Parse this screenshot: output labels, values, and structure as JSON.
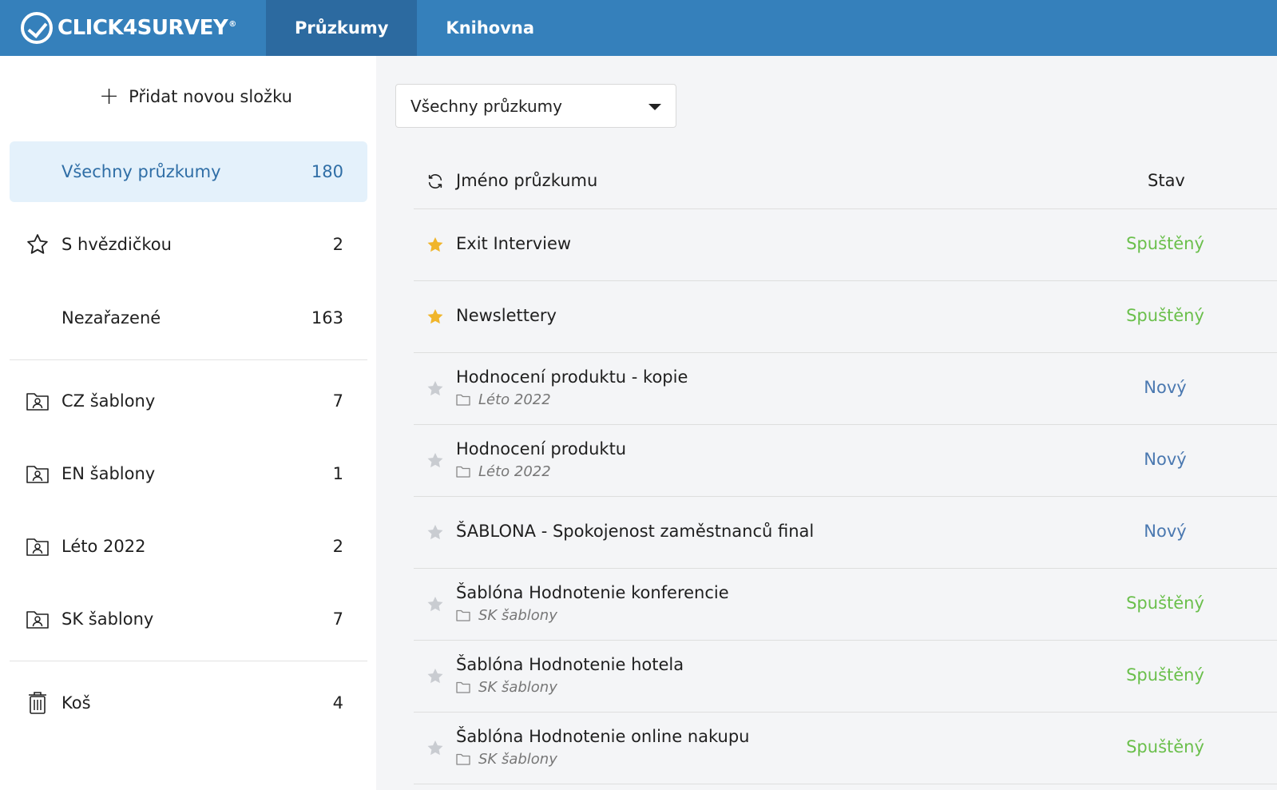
{
  "header": {
    "logo_text": "CLICK4SURVEY",
    "logo_reg": "®",
    "tabs": [
      {
        "label": "Průzkumy",
        "active": true
      },
      {
        "label": "Knihovna",
        "active": false
      }
    ]
  },
  "sidebar": {
    "add_folder_label": "Přidat novou složku",
    "items": [
      {
        "label": "Všechny průzkumy",
        "count": "180",
        "icon": "",
        "active": true
      },
      {
        "label": "S hvězdičkou",
        "count": "2",
        "icon": "star-outline-icon"
      },
      {
        "label": "Nezařazené",
        "count": "163",
        "icon": ""
      },
      {
        "label": "CZ šablony",
        "count": "7",
        "icon": "shared-folder-icon"
      },
      {
        "label": "EN šablony",
        "count": "1",
        "icon": "shared-folder-icon"
      },
      {
        "label": "Léto 2022",
        "count": "2",
        "icon": "shared-folder-icon"
      },
      {
        "label": "SK šablony",
        "count": "7",
        "icon": "shared-folder-icon"
      },
      {
        "label": "Koš",
        "count": "4",
        "icon": "trash-icon"
      }
    ]
  },
  "main": {
    "filter_value": "Všechny průzkumy",
    "table": {
      "col_name": "Jméno průzkumu",
      "col_status": "Stav",
      "rows": [
        {
          "name": "Exit Interview",
          "folder": "",
          "status": "Spuštěný",
          "starred": true
        },
        {
          "name": "Newslettery",
          "folder": "",
          "status": "Spuštěný",
          "starred": true
        },
        {
          "name": "Hodnocení produktu - kopie",
          "folder": "Léto 2022",
          "status": "Nový",
          "starred": false
        },
        {
          "name": "Hodnocení produktu",
          "folder": "Léto 2022",
          "status": "Nový",
          "starred": false
        },
        {
          "name": "ŠABLONA - Spokojenost zaměstnanců final",
          "folder": "",
          "status": "Nový",
          "starred": false
        },
        {
          "name": "Šablóna Hodnotenie konferencie",
          "folder": "SK šablony",
          "status": "Spuštěný",
          "starred": false
        },
        {
          "name": "Šablóna Hodnotenie hotela",
          "folder": "SK šablony",
          "status": "Spuštěný",
          "starred": false
        },
        {
          "name": "Šablóna Hodnotenie online nakupu",
          "folder": "SK šablony",
          "status": "Spuštěný",
          "starred": false
        }
      ]
    }
  },
  "colors": {
    "header_bg": "#3580bb",
    "active_tab_bg": "#2c6aa0",
    "status_running": "#6abf4b",
    "status_new": "#4a78b0",
    "star_active": "#f0b52a",
    "star_inactive": "#c9ccd1"
  }
}
